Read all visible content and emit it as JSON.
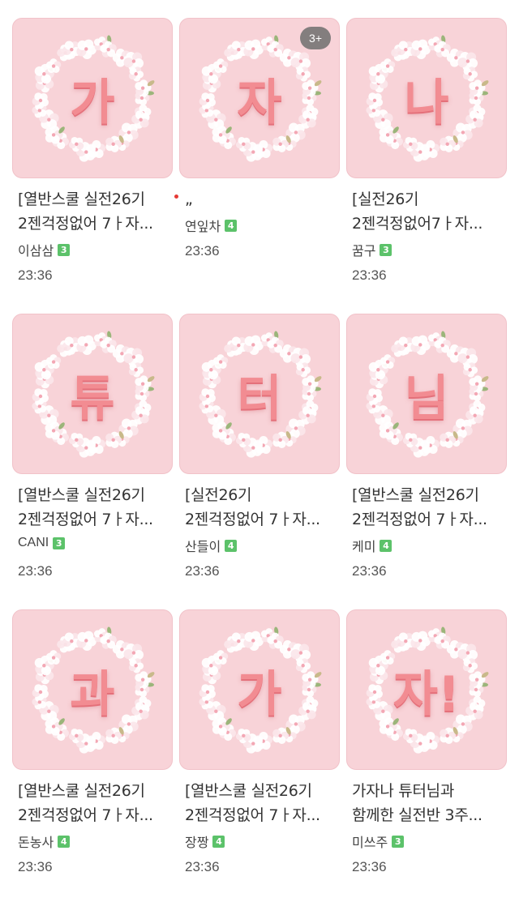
{
  "posts": [
    {
      "glyph": "가",
      "title_line1": "[열반스쿨 실전26기",
      "title_line2": "2젠걱정없어 7ㅏ자...",
      "author": "이삼삼",
      "level": "3",
      "time": "23:36",
      "badge": ""
    },
    {
      "glyph": "자",
      "title_line1": "„",
      "title_line2": "",
      "author": "연잎차",
      "level": "4",
      "time": "23:36",
      "badge": "3+"
    },
    {
      "glyph": "나",
      "title_line1": "[실전26기",
      "title_line2": "2젠걱정없어7ㅏ자...",
      "author": "꿈구",
      "level": "3",
      "time": "23:36",
      "badge": ""
    },
    {
      "glyph": "튜",
      "title_line1": "[열반스쿨 실전26기",
      "title_line2": "2젠걱정없어 7ㅏ자...",
      "author": "CANI",
      "level": "3",
      "time": "23:36",
      "badge": ""
    },
    {
      "glyph": "터",
      "title_line1": "[실전26기",
      "title_line2": "2젠걱정없어 7ㅏ자...",
      "author": "산들이",
      "level": "4",
      "time": "23:36",
      "badge": ""
    },
    {
      "glyph": "님",
      "title_line1": "[열반스쿨 실전26기",
      "title_line2": "2젠걱정없어 7ㅏ자...",
      "author": "케미",
      "level": "4",
      "time": "23:36",
      "badge": ""
    },
    {
      "glyph": "과",
      "title_line1": "[열반스쿨 실전26기",
      "title_line2": "2젠걱정없어 7ㅏ자...",
      "author": "돈농사",
      "level": "4",
      "time": "23:36",
      "badge": ""
    },
    {
      "glyph": "가",
      "title_line1": "[열반스쿨 실전26기",
      "title_line2": "2젠걱정없어 7ㅏ자...",
      "author": "장짱",
      "level": "4",
      "time": "23:36",
      "badge": ""
    },
    {
      "glyph": "자!",
      "title_line1": "가자나 튜터님과",
      "title_line2": "함께한 실전반 3주...",
      "author": "미쓰주",
      "level": "3",
      "time": "23:36",
      "badge": ""
    }
  ],
  "colors": {
    "thumb_bg": "#f8d3d8",
    "glyph": "#f28c92",
    "level_badge": "#5cc26a"
  },
  "icons": {
    "wreath": "cherry-blossom-wreath-icon"
  }
}
